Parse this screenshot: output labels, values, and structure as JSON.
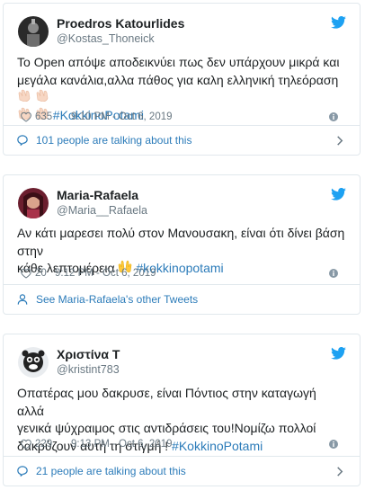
{
  "tweets": [
    {
      "display_name": "Proedros Katourlides",
      "handle": "@Kostas_Thoneick",
      "text_line1": "Το Open απόψε αποδεικνύει πως δεν υπάρχουν μικρά και",
      "text_line2": "μεγάλα κανάλια,αλλα πάθος για καλη ελληνική τηλεόραση",
      "hashtag": "#KokkinoPotami",
      "likes": "635",
      "timestamp": "9:10 PM - Oct 6, 2019",
      "footer": "101 people are talking about this",
      "footer_icon": "speech-bubble-icon",
      "emoji": "clapping-hands-emoji"
    },
    {
      "display_name": "Maria-Rafaela",
      "handle": "@Maria__Rafaela",
      "text_line1": "Αν κάτι μαρεσει πολύ στον Μανουσακη, είναι ότι δίνει βάση στην",
      "text_line2": "κάθε λεπτομέρεια",
      "hashtag": "#kokkinopotami",
      "likes": "20",
      "timestamp": "9:12 PM - Oct 6, 2019",
      "footer": "See Maria-Rafaela's other Tweets",
      "footer_icon": "person-icon",
      "emoji": "raising-hands-emoji"
    },
    {
      "display_name": "Χριστίνα Τ",
      "handle": "@kristint783",
      "text_line1": "Οπατέρας μου δακρυσε, είναι Πόντιος στην καταγωγή αλλά",
      "text_line2": "γενικά ψύχραιμος στις αντιδράσεις του!Νομίζω πολλοί",
      "text_line3": "δακρύζουν αυτή τη στιγμή !",
      "hashtag": "#KokkinoPotami",
      "likes": "229",
      "timestamp": "9:13 PM - Oct 6, 2019",
      "footer": "21 people are talking about this",
      "footer_icon": "speech-bubble-icon"
    }
  ],
  "colors": {
    "twitter_blue": "#1da1f2",
    "link": "#2b7bb9",
    "text": "#1c2022",
    "muted": "#697882",
    "border": "#e1e8ed"
  }
}
